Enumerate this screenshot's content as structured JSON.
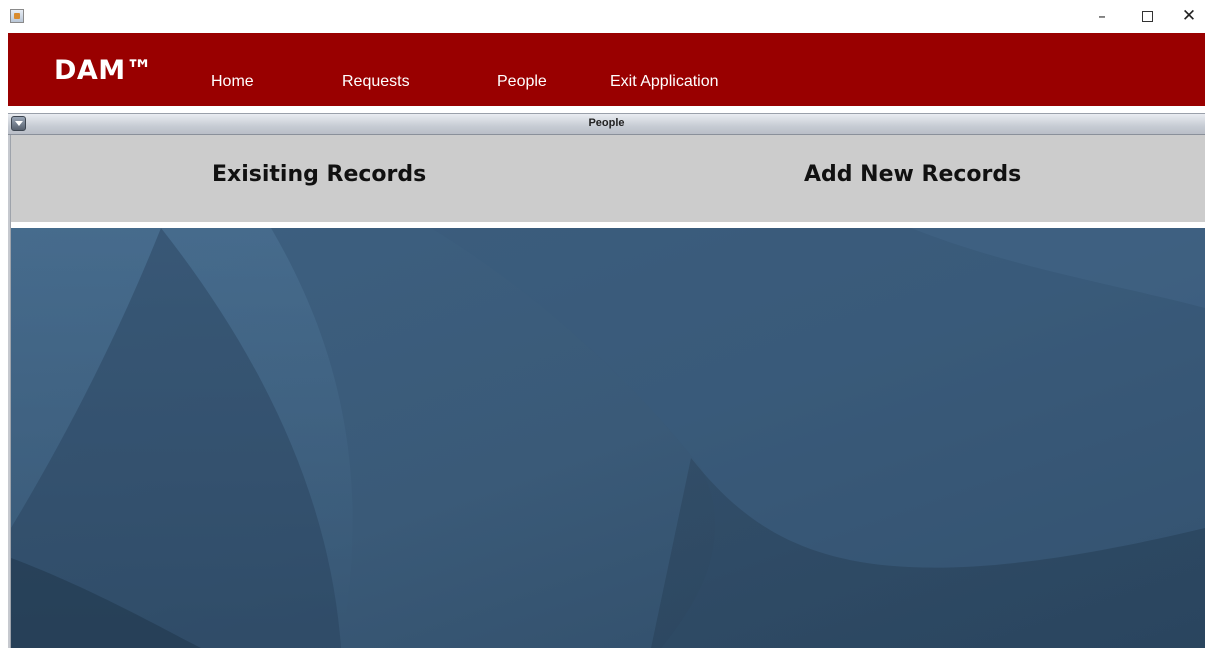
{
  "window": {
    "app_icon": "java-app-icon",
    "controls": {
      "minimize": "–",
      "maximize_icon": "maximize-icon",
      "close": "✕"
    }
  },
  "navbar": {
    "brand": "DAM™",
    "items": [
      {
        "label": "Home"
      },
      {
        "label": "Requests"
      },
      {
        "label": "People"
      },
      {
        "label": "Exit Application"
      }
    ],
    "color": "#990000"
  },
  "frame": {
    "title": "People",
    "tabs": [
      {
        "label": "Exisiting Records"
      },
      {
        "label": "Add New Records"
      }
    ]
  },
  "colors": {
    "tab_area": "#cccccc",
    "wallpaper_base": "#3b5a78"
  }
}
